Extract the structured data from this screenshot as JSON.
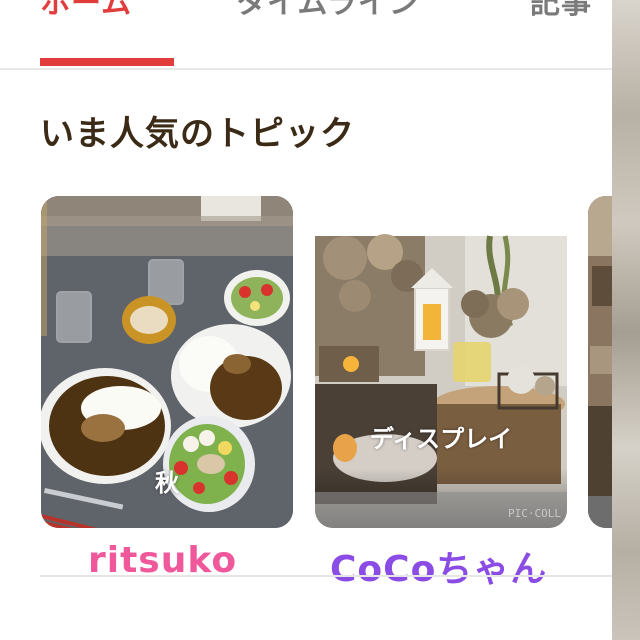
{
  "tabs": [
    {
      "label": "ホーム",
      "active": true
    },
    {
      "label": "タイムライン",
      "active": false
    },
    {
      "label": "記事",
      "active": false
    }
  ],
  "section": {
    "title": "いま人気のトピック"
  },
  "cards": [
    {
      "label": "秋",
      "user": "ritsuko",
      "user_color": "#f0589c"
    },
    {
      "label": "ディスプレイ",
      "user": "CoCoちゃん",
      "user_color": "#8b4ce6",
      "watermark": "PIC·COLL"
    },
    {
      "label": "",
      "user": ""
    }
  ],
  "colors": {
    "accent": "#e23d3d",
    "title": "#3b2a16",
    "tab_inactive": "#7a7a7a"
  }
}
